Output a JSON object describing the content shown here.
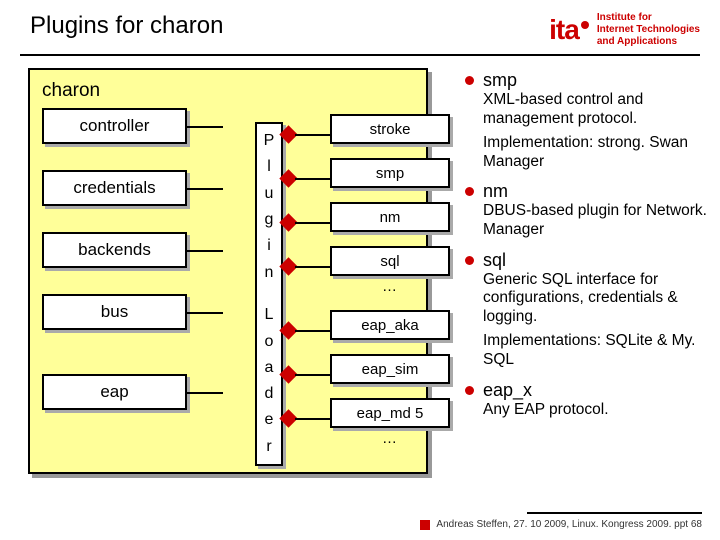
{
  "header": {
    "title": "Plugins for charon",
    "logo_text_line1": "Institute for",
    "logo_text_line2": "Internet Technologies",
    "logo_text_line3": "and Applications",
    "logo_letters": "ita"
  },
  "charon": {
    "title": "charon",
    "modules": [
      "controller",
      "credentials",
      "backends",
      "bus",
      "eap"
    ],
    "plugin_loader": [
      "P",
      "l",
      "u",
      "g",
      "i",
      "n",
      "",
      "L",
      "o",
      "a",
      "d",
      "e",
      "r"
    ],
    "plugins": [
      "stroke",
      "smp",
      "nm",
      "sql",
      "eap_aka",
      "eap_sim",
      "eap_md 5"
    ],
    "ellipsis1": "…",
    "ellipsis2": "…"
  },
  "bullets": [
    {
      "title": "smp",
      "desc": "XML-based control and management protocol.",
      "impl": "Implementation: strong. Swan Manager"
    },
    {
      "title": "nm",
      "desc": "DBUS-based plugin for Network. Manager"
    },
    {
      "title": "sql",
      "desc": "Generic SQL interface for configurations, credentials & logging.",
      "impl": "Implementations: SQLite & My. SQL"
    },
    {
      "title": "eap_x",
      "desc": "Any EAP protocol."
    }
  ],
  "footer": "Andreas Steffen, 27. 10 2009, Linux. Kongress 2009. ppt 68"
}
